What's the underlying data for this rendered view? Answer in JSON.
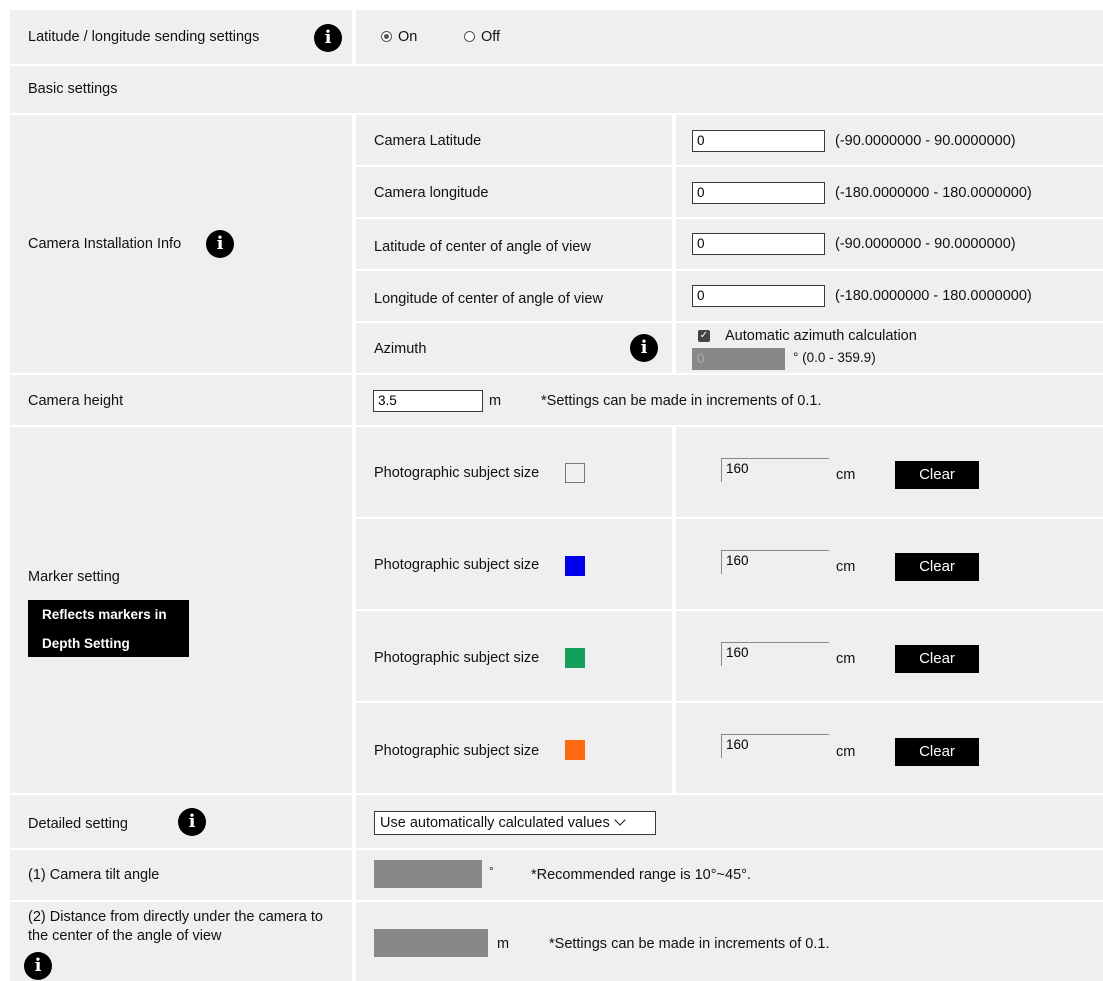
{
  "sending": {
    "label": "Latitude / longitude sending settings",
    "info_icon": "info-icon",
    "options": [
      {
        "label": "On",
        "selected": true
      },
      {
        "label": "Off",
        "selected": false
      }
    ]
  },
  "basic": {
    "label": "Basic settings"
  },
  "install": {
    "label": "Camera Installation Info",
    "info_icon": "info-icon",
    "rows": [
      {
        "label": "Camera Latitude",
        "value": "0",
        "range": "(-90.0000000 - 90.0000000)"
      },
      {
        "label": "Camera longitude",
        "value": "0",
        "range": "(-180.0000000 - 180.0000000)"
      },
      {
        "label": "Latitude of center of angle of view",
        "value": "0",
        "range": "(-90.0000000 - 90.0000000)"
      },
      {
        "label": "Longitude of center of angle of view",
        "value": "0",
        "range": "(-180.0000000 - 180.0000000)"
      }
    ],
    "azimuth": {
      "label": "Azimuth",
      "checkbox_label": "Automatic azimuth calculation",
      "checked": true,
      "value": "0",
      "range": "° (0.0 - 359.9)"
    }
  },
  "height": {
    "label": "Camera height",
    "value": "3.5",
    "unit": "m",
    "note": "*Settings can be made in increments of 0.1."
  },
  "marker": {
    "label": "Marker setting",
    "reflect_line1": "Reflects markers in",
    "reflect_line2": "Depth Setting",
    "rows": [
      {
        "label": "Photographic subject size",
        "color": "#ffffff",
        "value": "160",
        "unit": "cm",
        "button": "Clear"
      },
      {
        "label": "Photographic subject size",
        "color": "#0000ee",
        "value": "160",
        "unit": "cm",
        "button": "Clear"
      },
      {
        "label": "Photographic subject size",
        "color": "#14a05a",
        "value": "160",
        "unit": "cm",
        "button": "Clear"
      },
      {
        "label": "Photographic subject size",
        "color": "#ff6a10",
        "value": "160",
        "unit": "cm",
        "button": "Clear"
      }
    ]
  },
  "detailed": {
    "label": "Detailed setting",
    "selected": "Use automatically calculated values"
  },
  "tilt": {
    "label": "(1) Camera tilt angle",
    "unit": "°",
    "note": "*Recommended range is 10°~45°."
  },
  "distance": {
    "label_line1": "(2) Distance from directly under the camera to",
    "label_line2": "the center of the angle of view",
    "unit": "m",
    "note": "*Settings can be made in increments of 0.1."
  }
}
